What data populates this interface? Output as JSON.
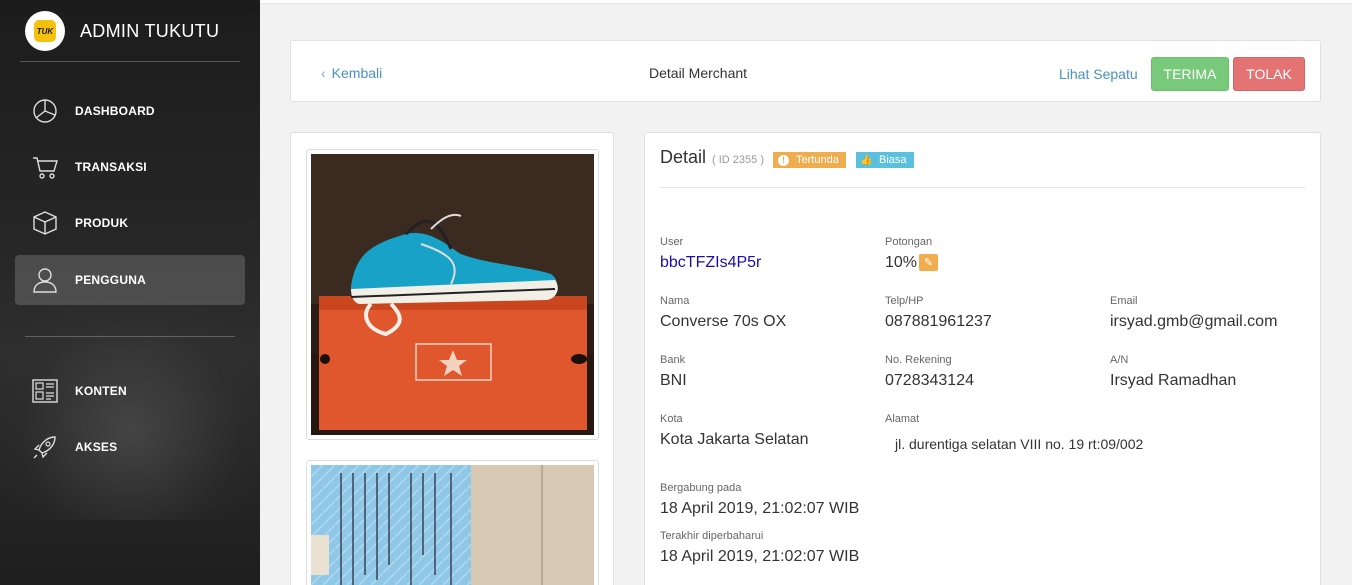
{
  "app": {
    "title": "ADMIN TUKUTU",
    "logo_text": "TUK"
  },
  "sidebar": {
    "items": [
      {
        "label": "DASHBOARD",
        "icon": "pie-chart-icon"
      },
      {
        "label": "TRANSAKSI",
        "icon": "cart-icon"
      },
      {
        "label": "PRODUK",
        "icon": "box-icon"
      },
      {
        "label": "PENGGUNA",
        "icon": "user-icon",
        "active": true
      },
      {
        "label": "KONTEN",
        "icon": "content-grid-icon"
      },
      {
        "label": "AKSES",
        "icon": "rocket-icon"
      }
    ]
  },
  "header": {
    "back_label": "Kembali",
    "title": "Detail Merchant",
    "view_shoes_label": "Lihat Sepatu",
    "accept_label": "TERIMA",
    "reject_label": "TOLAK"
  },
  "detail": {
    "title": "Detail",
    "id_text": "( ID 2355 )",
    "status_badge": "Tertunda",
    "type_badge": "Biasa",
    "fields": {
      "user": {
        "label": "User",
        "value": "bbcTFZIs4P5r"
      },
      "potongan": {
        "label": "Potongan",
        "value": "10%"
      },
      "nama": {
        "label": "Nama",
        "value": "Converse 70s OX"
      },
      "telp": {
        "label": "Telp/HP",
        "value": "087881961237"
      },
      "email": {
        "label": "Email",
        "value": "irsyad.gmb@gmail.com"
      },
      "bank": {
        "label": "Bank",
        "value": "BNI"
      },
      "rekening": {
        "label": "No. Rekening",
        "value": "0728343124"
      },
      "an": {
        "label": "A/N",
        "value": "Irsyad Ramadhan"
      },
      "kota": {
        "label": "Kota",
        "value": "Kota Jakarta Selatan"
      },
      "alamat": {
        "label": "Alamat",
        "value": "jl. durentiga selatan VIII no. 19 rt:09/002"
      },
      "bergabung": {
        "label": "Bergabung pada",
        "value": "18 April 2019, 21:02:07 WIB"
      },
      "diperbaharui": {
        "label": "Terakhir diperbaharui",
        "value": "18 April 2019, 21:02:07 WIB"
      }
    }
  },
  "colors": {
    "accent_link": "#4a90c2",
    "accept": "#78c97a",
    "reject": "#e47373",
    "warning": "#f0ad4e",
    "info": "#5bc0de",
    "brand_yellow": "#f4c20d"
  }
}
